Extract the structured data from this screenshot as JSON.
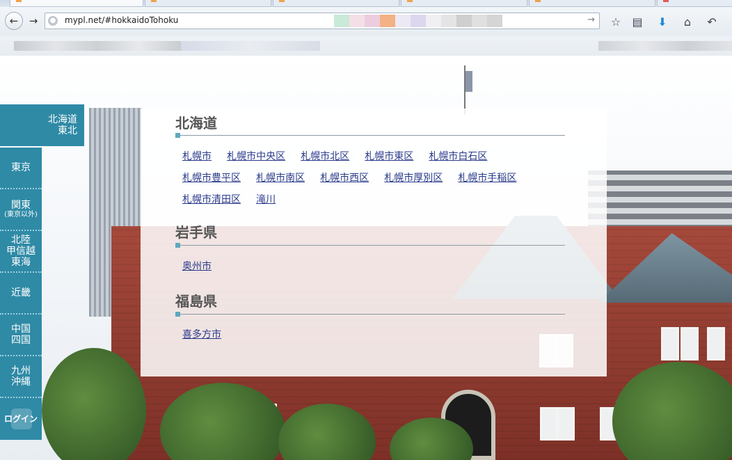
{
  "browser": {
    "url": "mypl.net/#hokkaidoTohoku",
    "back_icon": "←",
    "forward_icon": "→",
    "go_icon": "→",
    "toolbar_icons": [
      {
        "name": "bookmark-star-icon",
        "glyph": "☆"
      },
      {
        "name": "reading-list-icon",
        "glyph": "▤"
      },
      {
        "name": "download-icon",
        "glyph": "⬇"
      },
      {
        "name": "home-icon",
        "glyph": "⌂"
      },
      {
        "name": "undo-icon",
        "glyph": "↶"
      }
    ]
  },
  "sidebar": {
    "items": [
      {
        "line1": "北海道",
        "line2": "東北",
        "line3": "",
        "sub": ""
      },
      {
        "line1": "東京",
        "line2": "",
        "line3": "",
        "sub": ""
      },
      {
        "line1": "関東",
        "line2": "",
        "line3": "",
        "sub": "(東京以外)"
      },
      {
        "line1": "北陸",
        "line2": "甲信越",
        "line3": "東海",
        "sub": ""
      },
      {
        "line1": "近畿",
        "line2": "",
        "line3": "",
        "sub": ""
      },
      {
        "line1": "中国",
        "line2": "四国",
        "line3": "",
        "sub": ""
      },
      {
        "line1": "九州",
        "line2": "沖縄",
        "line3": "",
        "sub": ""
      }
    ],
    "login_label": "ログイン"
  },
  "sections": [
    {
      "title": "北海道",
      "rows": [
        [
          "札幌市",
          "札幌市中央区",
          "札幌市北区",
          "札幌市東区",
          "札幌市白石区"
        ],
        [
          "札幌市豊平区",
          "札幌市南区",
          "札幌市西区",
          "札幌市厚別区",
          "札幌市手稲区"
        ],
        [
          "札幌市清田区",
          "滝川"
        ]
      ]
    },
    {
      "title": "岩手県",
      "rows": [
        [
          "奥州市"
        ]
      ]
    },
    {
      "title": "福島県",
      "rows": [
        [
          "喜多方市"
        ]
      ]
    }
  ],
  "colors": {
    "sidebar": "#2f8aa6",
    "link": "#2a3a8a",
    "accent_mark": "#5ea8bf"
  }
}
